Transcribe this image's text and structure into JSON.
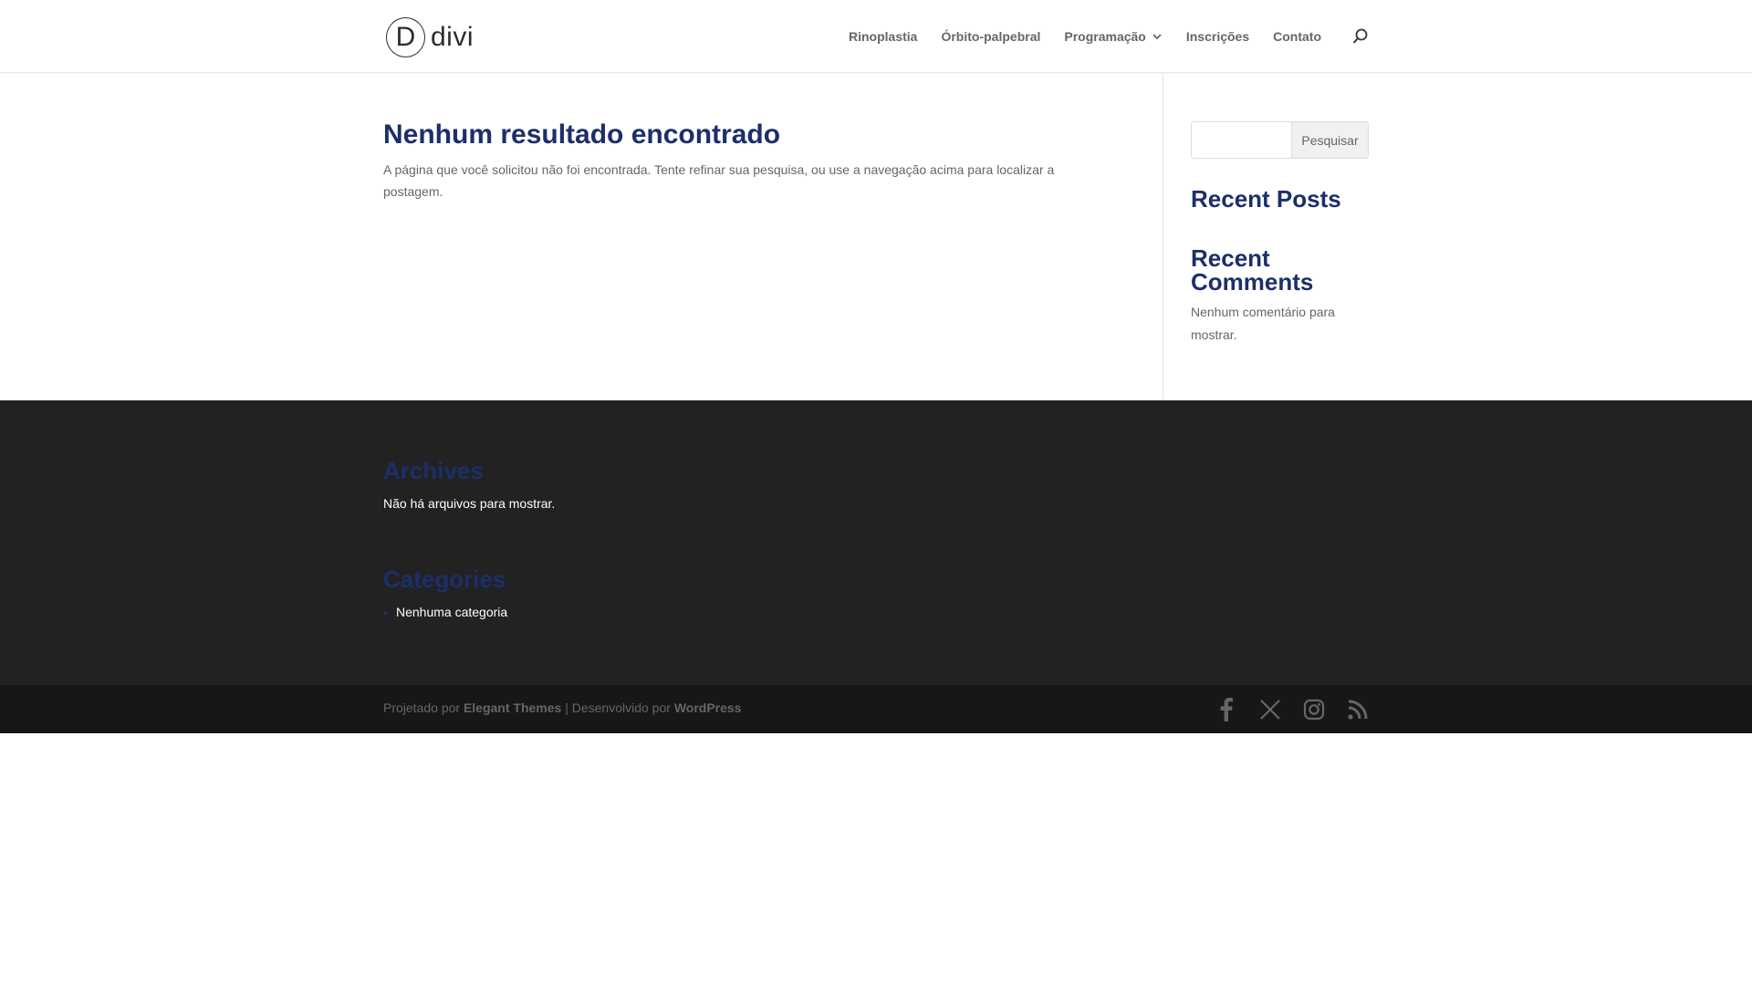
{
  "header": {
    "logo_letter": "D",
    "logo_word": "divi",
    "nav": [
      {
        "label": "Rinoplastia"
      },
      {
        "label": "Órbito-palpebral"
      },
      {
        "label": "Programação"
      },
      {
        "label": "Inscrições"
      },
      {
        "label": "Contato"
      }
    ]
  },
  "main": {
    "title": "Nenhum resultado encontrado",
    "text": "A página que você solicitou não foi encontrada. Tente refinar sua pesquisa, ou use a navegação acima para localizar a postagem."
  },
  "sidebar": {
    "search_value": "",
    "search_button": "Pesquisar",
    "recent_posts_title": "Recent Posts",
    "recent_comments_title": "Recent Comments",
    "recent_comments_text": "Nenhum comentário para mostrar."
  },
  "footer": {
    "archives_title": "Archives",
    "archives_text": "Não há arquivos para mostrar.",
    "categories_title": "Categories",
    "categories_item": "Nenhuma categoria"
  },
  "bottom": {
    "designed_by": "Projetado por",
    "elegant": "Elegant Themes",
    "separator": "| Desenvolvido por",
    "wordpress": "WordPress"
  },
  "icons": {
    "facebook": "facebook-icon",
    "x": "x-icon",
    "instagram": "instagram-icon",
    "rss": "rss-icon",
    "search": "search-icon",
    "chevron": "chevron-down-icon"
  },
  "colors": {
    "heading": "#1c2f6b",
    "footer_bg": "#222222",
    "bottom_bg": "#171717"
  }
}
